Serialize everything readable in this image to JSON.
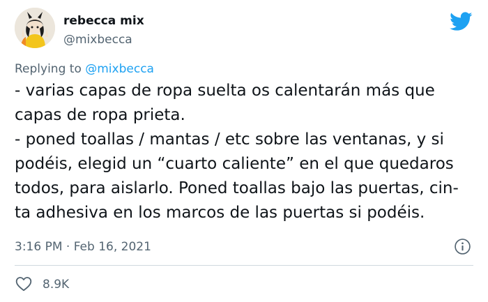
{
  "author": {
    "name": "rebecca mix",
    "handle": "@mixbecca",
    "avatar_icon": "avatar-icon"
  },
  "brand_icon": "twitter-bird-icon",
  "reply": {
    "prefix": "Replying to ",
    "mention": "@mixbecca"
  },
  "tweet": {
    "lines": [
      "- varias capas de ropa suelta os calentarán más que",
      "capas de ropa prieta.",
      "- poned toallas / mantas / etc sobre las ventanas, y si",
      "podéis, elegid un “cuarto caliente” en el que quedaros",
      "todos, para aislarlo. Poned toallas bajo las puertas, cin-",
      "ta adhesiva en los marcos de las puertas si podéis."
    ]
  },
  "meta": {
    "timestamp": "3:16 PM · Feb 16, 2021",
    "info_icon": "info-icon"
  },
  "stats": {
    "likes": "8.9K",
    "like_icon": "heart-icon"
  },
  "colors": {
    "brand": "#1da1f2",
    "text": "#0f1419",
    "secondary": "#536471",
    "divider": "#cfd9de"
  }
}
